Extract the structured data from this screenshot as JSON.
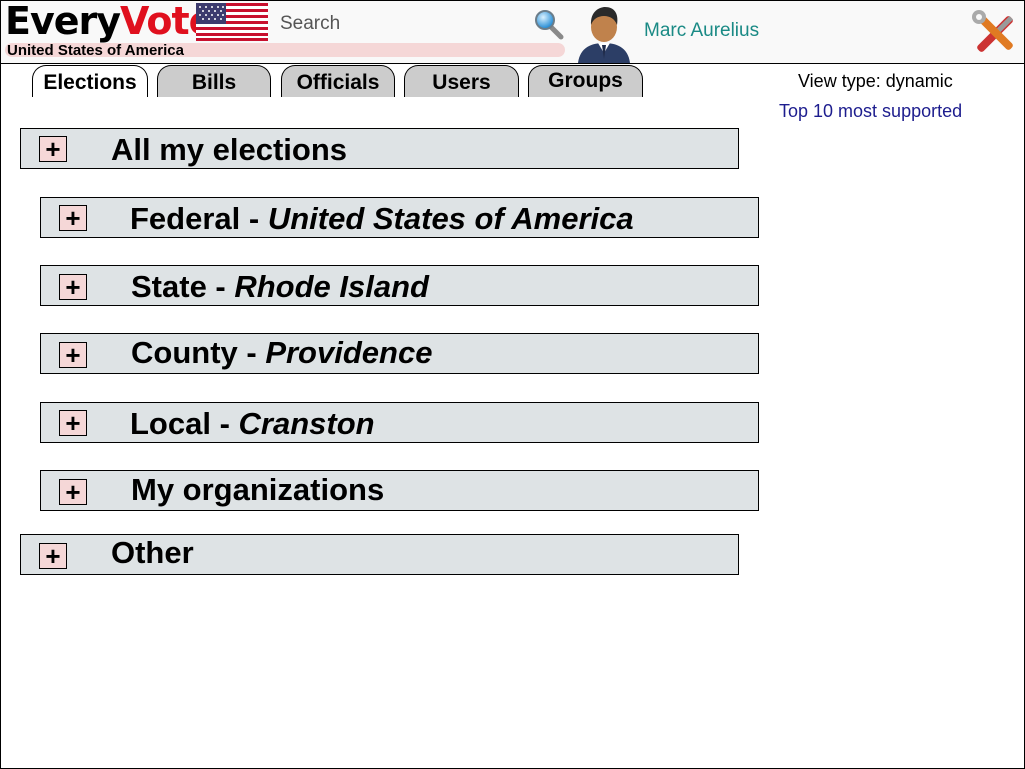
{
  "brand": {
    "every": "Every",
    "vote": "Vote"
  },
  "header": {
    "country": "United States of America",
    "search_placeholder": "Search",
    "username": "Marc Aurelius"
  },
  "tabs": [
    {
      "label": "Elections",
      "active": true
    },
    {
      "label": "Bills",
      "active": false
    },
    {
      "label": "Officials",
      "active": false
    },
    {
      "label": "Users",
      "active": false
    },
    {
      "label": "Groups",
      "active": false
    }
  ],
  "sidepanel": {
    "view_type": "View type: dynamic",
    "top_link": "Top 10 most supported"
  },
  "sections": [
    {
      "expand": "+",
      "title": "All my elections",
      "detail": ""
    },
    {
      "expand": "+",
      "title": "Federal - ",
      "detail": "United States of America"
    },
    {
      "expand": "+",
      "title": "State - ",
      "detail": "Rhode Island"
    },
    {
      "expand": "+",
      "title": "County - ",
      "detail": "Providence"
    },
    {
      "expand": "+",
      "title": "Local - ",
      "detail": "Cranston"
    },
    {
      "expand": "+",
      "title": "My organizations",
      "detail": ""
    },
    {
      "expand": "+",
      "title": "Other",
      "detail": ""
    }
  ],
  "icons": {
    "flag": "us-flag-icon",
    "search": "magnifier-icon",
    "avatar": "user-avatar-icon",
    "settings": "tools-icon"
  },
  "colors": {
    "brand_red": "#e0101e",
    "username": "#1a8a85",
    "link": "#1d1d8e",
    "row_bg": "#dee3e5",
    "plus_bg": "#f5d7d7"
  }
}
